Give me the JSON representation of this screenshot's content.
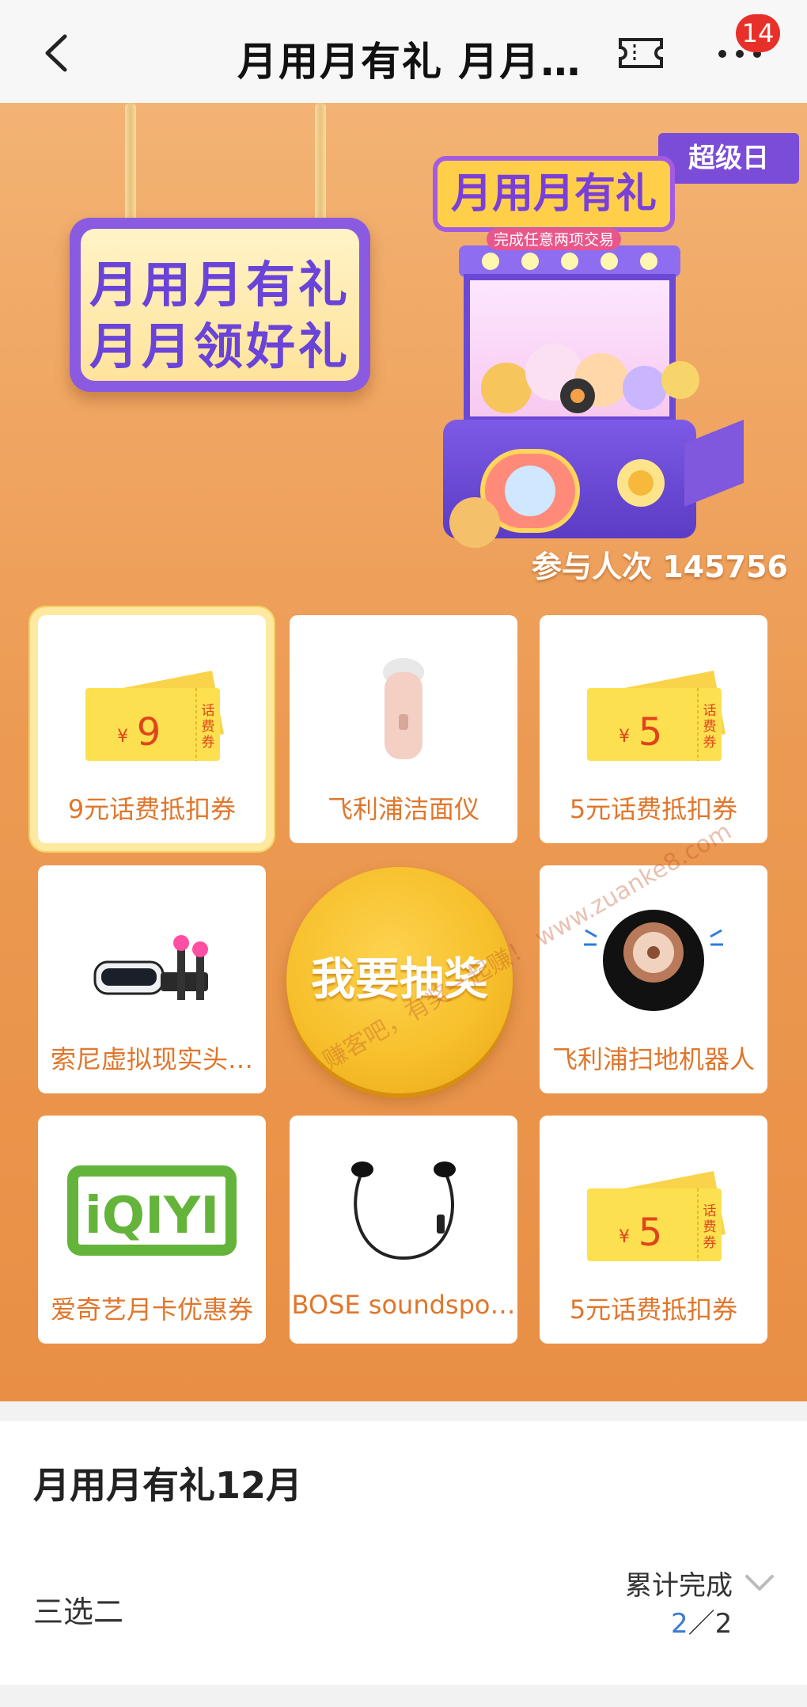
{
  "topbar": {
    "title": "月用月有礼 月月…",
    "notification_count": "14"
  },
  "banner": {
    "sign_line1": "月用月有礼",
    "sign_line2": "月月领好礼",
    "machine_title": "月用月有礼",
    "machine_subtitle": "完成任意两项交易",
    "super_day_badge": "超级日",
    "participants": "参与人次 145756"
  },
  "prizes": [
    {
      "label": "9元话费抵扣券",
      "amount": "9",
      "coupon_tag": "话费券",
      "currency": "¥"
    },
    {
      "label": "飞利浦洁面仪"
    },
    {
      "label": "5元话费抵扣券",
      "amount": "5",
      "coupon_tag": "话费券",
      "currency": "¥"
    },
    {
      "label": "索尼虚拟现实头…"
    },
    {
      "label": "飞利浦扫地机器人"
    },
    {
      "label": "爱奇艺月卡优惠券",
      "logo_text": "iQIYI"
    },
    {
      "label": "BOSE soundspo…"
    },
    {
      "label": "5元话费抵扣券",
      "amount": "5",
      "coupon_tag": "话费券",
      "currency": "¥"
    }
  ],
  "draw_button": "我要抽奖",
  "watermark": "赚客吧，有奖一起赚！ www.zuanke8.com",
  "section": {
    "title": "月用月有礼12月",
    "task_name": "三选二",
    "status_label": "累计完成",
    "progress_done": "2",
    "progress_sep": "／",
    "progress_total": "2"
  },
  "colors": {
    "accent_orange": "#e0762b",
    "purple": "#7b4cd8",
    "badge_red": "#e8302a",
    "progress_blue": "#3a7bd5"
  }
}
